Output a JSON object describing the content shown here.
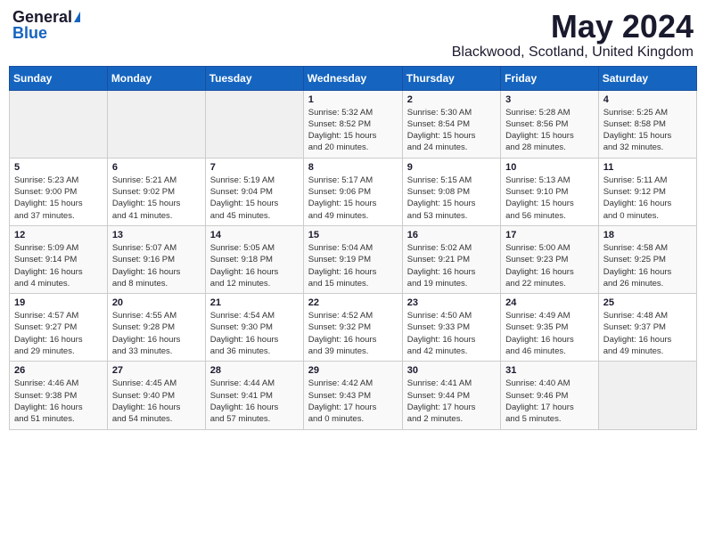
{
  "header": {
    "logo_general": "General",
    "logo_blue": "Blue",
    "month_title": "May 2024",
    "location": "Blackwood, Scotland, United Kingdom"
  },
  "days_of_week": [
    "Sunday",
    "Monday",
    "Tuesday",
    "Wednesday",
    "Thursday",
    "Friday",
    "Saturday"
  ],
  "weeks": [
    [
      {
        "day": "",
        "info": ""
      },
      {
        "day": "",
        "info": ""
      },
      {
        "day": "",
        "info": ""
      },
      {
        "day": "1",
        "info": "Sunrise: 5:32 AM\nSunset: 8:52 PM\nDaylight: 15 hours\nand 20 minutes."
      },
      {
        "day": "2",
        "info": "Sunrise: 5:30 AM\nSunset: 8:54 PM\nDaylight: 15 hours\nand 24 minutes."
      },
      {
        "day": "3",
        "info": "Sunrise: 5:28 AM\nSunset: 8:56 PM\nDaylight: 15 hours\nand 28 minutes."
      },
      {
        "day": "4",
        "info": "Sunrise: 5:25 AM\nSunset: 8:58 PM\nDaylight: 15 hours\nand 32 minutes."
      }
    ],
    [
      {
        "day": "5",
        "info": "Sunrise: 5:23 AM\nSunset: 9:00 PM\nDaylight: 15 hours\nand 37 minutes."
      },
      {
        "day": "6",
        "info": "Sunrise: 5:21 AM\nSunset: 9:02 PM\nDaylight: 15 hours\nand 41 minutes."
      },
      {
        "day": "7",
        "info": "Sunrise: 5:19 AM\nSunset: 9:04 PM\nDaylight: 15 hours\nand 45 minutes."
      },
      {
        "day": "8",
        "info": "Sunrise: 5:17 AM\nSunset: 9:06 PM\nDaylight: 15 hours\nand 49 minutes."
      },
      {
        "day": "9",
        "info": "Sunrise: 5:15 AM\nSunset: 9:08 PM\nDaylight: 15 hours\nand 53 minutes."
      },
      {
        "day": "10",
        "info": "Sunrise: 5:13 AM\nSunset: 9:10 PM\nDaylight: 15 hours\nand 56 minutes."
      },
      {
        "day": "11",
        "info": "Sunrise: 5:11 AM\nSunset: 9:12 PM\nDaylight: 16 hours\nand 0 minutes."
      }
    ],
    [
      {
        "day": "12",
        "info": "Sunrise: 5:09 AM\nSunset: 9:14 PM\nDaylight: 16 hours\nand 4 minutes."
      },
      {
        "day": "13",
        "info": "Sunrise: 5:07 AM\nSunset: 9:16 PM\nDaylight: 16 hours\nand 8 minutes."
      },
      {
        "day": "14",
        "info": "Sunrise: 5:05 AM\nSunset: 9:18 PM\nDaylight: 16 hours\nand 12 minutes."
      },
      {
        "day": "15",
        "info": "Sunrise: 5:04 AM\nSunset: 9:19 PM\nDaylight: 16 hours\nand 15 minutes."
      },
      {
        "day": "16",
        "info": "Sunrise: 5:02 AM\nSunset: 9:21 PM\nDaylight: 16 hours\nand 19 minutes."
      },
      {
        "day": "17",
        "info": "Sunrise: 5:00 AM\nSunset: 9:23 PM\nDaylight: 16 hours\nand 22 minutes."
      },
      {
        "day": "18",
        "info": "Sunrise: 4:58 AM\nSunset: 9:25 PM\nDaylight: 16 hours\nand 26 minutes."
      }
    ],
    [
      {
        "day": "19",
        "info": "Sunrise: 4:57 AM\nSunset: 9:27 PM\nDaylight: 16 hours\nand 29 minutes."
      },
      {
        "day": "20",
        "info": "Sunrise: 4:55 AM\nSunset: 9:28 PM\nDaylight: 16 hours\nand 33 minutes."
      },
      {
        "day": "21",
        "info": "Sunrise: 4:54 AM\nSunset: 9:30 PM\nDaylight: 16 hours\nand 36 minutes."
      },
      {
        "day": "22",
        "info": "Sunrise: 4:52 AM\nSunset: 9:32 PM\nDaylight: 16 hours\nand 39 minutes."
      },
      {
        "day": "23",
        "info": "Sunrise: 4:50 AM\nSunset: 9:33 PM\nDaylight: 16 hours\nand 42 minutes."
      },
      {
        "day": "24",
        "info": "Sunrise: 4:49 AM\nSunset: 9:35 PM\nDaylight: 16 hours\nand 46 minutes."
      },
      {
        "day": "25",
        "info": "Sunrise: 4:48 AM\nSunset: 9:37 PM\nDaylight: 16 hours\nand 49 minutes."
      }
    ],
    [
      {
        "day": "26",
        "info": "Sunrise: 4:46 AM\nSunset: 9:38 PM\nDaylight: 16 hours\nand 51 minutes."
      },
      {
        "day": "27",
        "info": "Sunrise: 4:45 AM\nSunset: 9:40 PM\nDaylight: 16 hours\nand 54 minutes."
      },
      {
        "day": "28",
        "info": "Sunrise: 4:44 AM\nSunset: 9:41 PM\nDaylight: 16 hours\nand 57 minutes."
      },
      {
        "day": "29",
        "info": "Sunrise: 4:42 AM\nSunset: 9:43 PM\nDaylight: 17 hours\nand 0 minutes."
      },
      {
        "day": "30",
        "info": "Sunrise: 4:41 AM\nSunset: 9:44 PM\nDaylight: 17 hours\nand 2 minutes."
      },
      {
        "day": "31",
        "info": "Sunrise: 4:40 AM\nSunset: 9:46 PM\nDaylight: 17 hours\nand 5 minutes."
      },
      {
        "day": "",
        "info": ""
      }
    ]
  ]
}
